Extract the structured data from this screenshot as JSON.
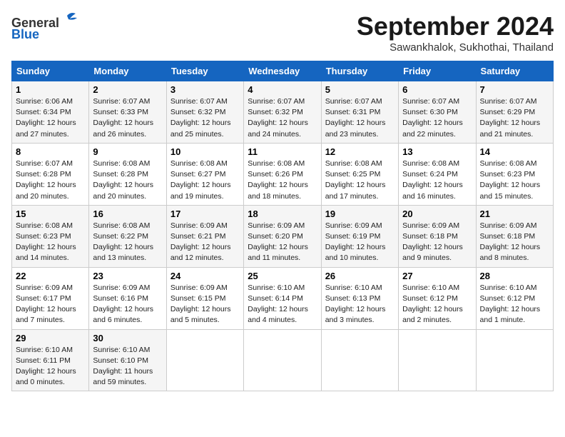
{
  "header": {
    "logo_general": "General",
    "logo_blue": "Blue",
    "month": "September 2024",
    "location": "Sawankhalok, Sukhothai, Thailand"
  },
  "weekdays": [
    "Sunday",
    "Monday",
    "Tuesday",
    "Wednesday",
    "Thursday",
    "Friday",
    "Saturday"
  ],
  "weeks": [
    [
      {
        "day": "1",
        "info": "Sunrise: 6:06 AM\nSunset: 6:34 PM\nDaylight: 12 hours\nand 27 minutes."
      },
      {
        "day": "2",
        "info": "Sunrise: 6:07 AM\nSunset: 6:33 PM\nDaylight: 12 hours\nand 26 minutes."
      },
      {
        "day": "3",
        "info": "Sunrise: 6:07 AM\nSunset: 6:32 PM\nDaylight: 12 hours\nand 25 minutes."
      },
      {
        "day": "4",
        "info": "Sunrise: 6:07 AM\nSunset: 6:32 PM\nDaylight: 12 hours\nand 24 minutes."
      },
      {
        "day": "5",
        "info": "Sunrise: 6:07 AM\nSunset: 6:31 PM\nDaylight: 12 hours\nand 23 minutes."
      },
      {
        "day": "6",
        "info": "Sunrise: 6:07 AM\nSunset: 6:30 PM\nDaylight: 12 hours\nand 22 minutes."
      },
      {
        "day": "7",
        "info": "Sunrise: 6:07 AM\nSunset: 6:29 PM\nDaylight: 12 hours\nand 21 minutes."
      }
    ],
    [
      {
        "day": "8",
        "info": "Sunrise: 6:07 AM\nSunset: 6:28 PM\nDaylight: 12 hours\nand 20 minutes."
      },
      {
        "day": "9",
        "info": "Sunrise: 6:08 AM\nSunset: 6:28 PM\nDaylight: 12 hours\nand 20 minutes."
      },
      {
        "day": "10",
        "info": "Sunrise: 6:08 AM\nSunset: 6:27 PM\nDaylight: 12 hours\nand 19 minutes."
      },
      {
        "day": "11",
        "info": "Sunrise: 6:08 AM\nSunset: 6:26 PM\nDaylight: 12 hours\nand 18 minutes."
      },
      {
        "day": "12",
        "info": "Sunrise: 6:08 AM\nSunset: 6:25 PM\nDaylight: 12 hours\nand 17 minutes."
      },
      {
        "day": "13",
        "info": "Sunrise: 6:08 AM\nSunset: 6:24 PM\nDaylight: 12 hours\nand 16 minutes."
      },
      {
        "day": "14",
        "info": "Sunrise: 6:08 AM\nSunset: 6:23 PM\nDaylight: 12 hours\nand 15 minutes."
      }
    ],
    [
      {
        "day": "15",
        "info": "Sunrise: 6:08 AM\nSunset: 6:23 PM\nDaylight: 12 hours\nand 14 minutes."
      },
      {
        "day": "16",
        "info": "Sunrise: 6:08 AM\nSunset: 6:22 PM\nDaylight: 12 hours\nand 13 minutes."
      },
      {
        "day": "17",
        "info": "Sunrise: 6:09 AM\nSunset: 6:21 PM\nDaylight: 12 hours\nand 12 minutes."
      },
      {
        "day": "18",
        "info": "Sunrise: 6:09 AM\nSunset: 6:20 PM\nDaylight: 12 hours\nand 11 minutes."
      },
      {
        "day": "19",
        "info": "Sunrise: 6:09 AM\nSunset: 6:19 PM\nDaylight: 12 hours\nand 10 minutes."
      },
      {
        "day": "20",
        "info": "Sunrise: 6:09 AM\nSunset: 6:18 PM\nDaylight: 12 hours\nand 9 minutes."
      },
      {
        "day": "21",
        "info": "Sunrise: 6:09 AM\nSunset: 6:18 PM\nDaylight: 12 hours\nand 8 minutes."
      }
    ],
    [
      {
        "day": "22",
        "info": "Sunrise: 6:09 AM\nSunset: 6:17 PM\nDaylight: 12 hours\nand 7 minutes."
      },
      {
        "day": "23",
        "info": "Sunrise: 6:09 AM\nSunset: 6:16 PM\nDaylight: 12 hours\nand 6 minutes."
      },
      {
        "day": "24",
        "info": "Sunrise: 6:09 AM\nSunset: 6:15 PM\nDaylight: 12 hours\nand 5 minutes."
      },
      {
        "day": "25",
        "info": "Sunrise: 6:10 AM\nSunset: 6:14 PM\nDaylight: 12 hours\nand 4 minutes."
      },
      {
        "day": "26",
        "info": "Sunrise: 6:10 AM\nSunset: 6:13 PM\nDaylight: 12 hours\nand 3 minutes."
      },
      {
        "day": "27",
        "info": "Sunrise: 6:10 AM\nSunset: 6:12 PM\nDaylight: 12 hours\nand 2 minutes."
      },
      {
        "day": "28",
        "info": "Sunrise: 6:10 AM\nSunset: 6:12 PM\nDaylight: 12 hours\nand 1 minute."
      }
    ],
    [
      {
        "day": "29",
        "info": "Sunrise: 6:10 AM\nSunset: 6:11 PM\nDaylight: 12 hours\nand 0 minutes."
      },
      {
        "day": "30",
        "info": "Sunrise: 6:10 AM\nSunset: 6:10 PM\nDaylight: 11 hours\nand 59 minutes."
      },
      {
        "day": "",
        "info": ""
      },
      {
        "day": "",
        "info": ""
      },
      {
        "day": "",
        "info": ""
      },
      {
        "day": "",
        "info": ""
      },
      {
        "day": "",
        "info": ""
      }
    ]
  ]
}
